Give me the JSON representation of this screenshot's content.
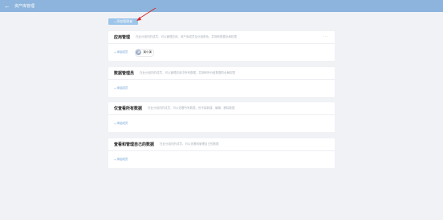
{
  "topbar": {
    "title": "资产库管理"
  },
  "add_admin_button": {
    "label": "添加管理者"
  },
  "cards": [
    {
      "title": "应用管理",
      "desc": "在此分组内的成员，可以管理应用、资产库成员及分组角色，并拥有数据全局权限",
      "add_label": "添加成员",
      "member": {
        "avatar": "演",
        "name": "演小演"
      }
    },
    {
      "title": "数据管理员",
      "desc": "在此分组内的成员，可以管理应用中所有数据，并拥有所分组数据的全局权限"
    },
    {
      "title": "仅查看所有数据",
      "desc": "在此分组内的成员，可以查看所有数据，但不能新建、编辑、删除数据"
    },
    {
      "title": "查看和管理自己的数据",
      "desc": "在此分组内的成员，可以查看和管理自己的数据"
    }
  ],
  "colors": {
    "topbar": "#8cb4dc",
    "accent": "#6b9fd4",
    "annotation_arrow": "#d62828"
  }
}
